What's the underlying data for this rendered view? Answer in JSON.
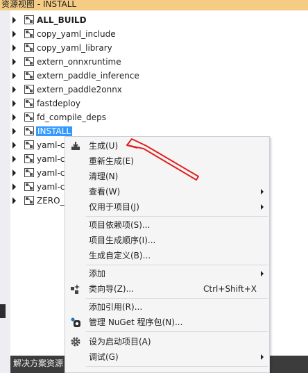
{
  "window": {
    "title": "资源视图 - INSTALL"
  },
  "tree": {
    "items": [
      {
        "label": "ALL_BUILD",
        "bold": true
      },
      {
        "label": "copy_yaml_include"
      },
      {
        "label": "copy_yaml_library"
      },
      {
        "label": "extern_onnxruntime"
      },
      {
        "label": "extern_paddle_inference"
      },
      {
        "label": "extern_paddle2onnx"
      },
      {
        "label": "fastdeploy"
      },
      {
        "label": "fd_compile_deps"
      },
      {
        "label": "INSTALL",
        "selected": true
      },
      {
        "label": "yaml-c"
      },
      {
        "label": "yaml-c"
      },
      {
        "label": "yaml-c"
      },
      {
        "label": "yaml-c"
      },
      {
        "label": "ZERO_"
      }
    ]
  },
  "bottom_bar": {
    "label": "解决方案资源"
  },
  "context_menu": {
    "items": [
      {
        "label": "生成(U)",
        "icon": "build-icon"
      },
      {
        "label": "重新生成(E)"
      },
      {
        "label": "清理(N)"
      },
      {
        "label": "查看(W)",
        "submenu": true
      },
      {
        "label": "仅用于项目(J)",
        "submenu": true
      },
      {
        "label": "项目依赖项(S)..."
      },
      {
        "label": "项目生成顺序(I)..."
      },
      {
        "label": "生成自定义(B)..."
      },
      {
        "label": "添加",
        "submenu": true
      },
      {
        "label": "类向导(Z)...",
        "shortcut": "Ctrl+Shift+X",
        "icon": "class-wizard-icon"
      },
      {
        "label": "添加引用(R)..."
      },
      {
        "label": "管理 NuGet 程序包(N)...",
        "icon": "nuget-icon"
      },
      {
        "label": "设为启动项目(A)",
        "icon": "gear-icon"
      },
      {
        "label": "调试(G)",
        "submenu": true
      }
    ]
  },
  "colors": {
    "title_bar": "#f5cc84",
    "selection": "#3399ff",
    "annotation_arrow": "#e02020",
    "menu_background": "#f5f5f5"
  }
}
